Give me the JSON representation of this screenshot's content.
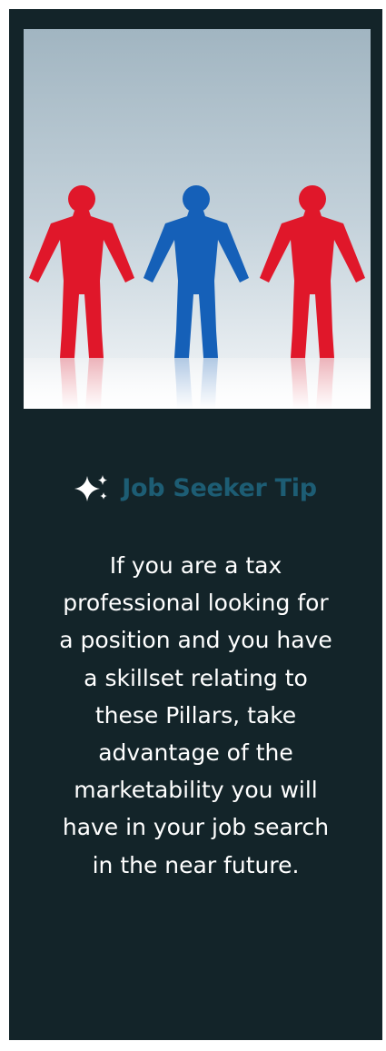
{
  "tip": {
    "icon": "sparkle-icon",
    "title": "Job Seeker Tip",
    "body": "If you are a tax professional looking for a position and you have a skillset relating to these Pillars, take advantage of the marketability you will have in your job search in the near future."
  },
  "colors": {
    "card_background": "#132429",
    "title": "#1d5d74",
    "body_text": "#ffffff",
    "figure_red": "#e0172a",
    "figure_blue": "#1560b8"
  }
}
